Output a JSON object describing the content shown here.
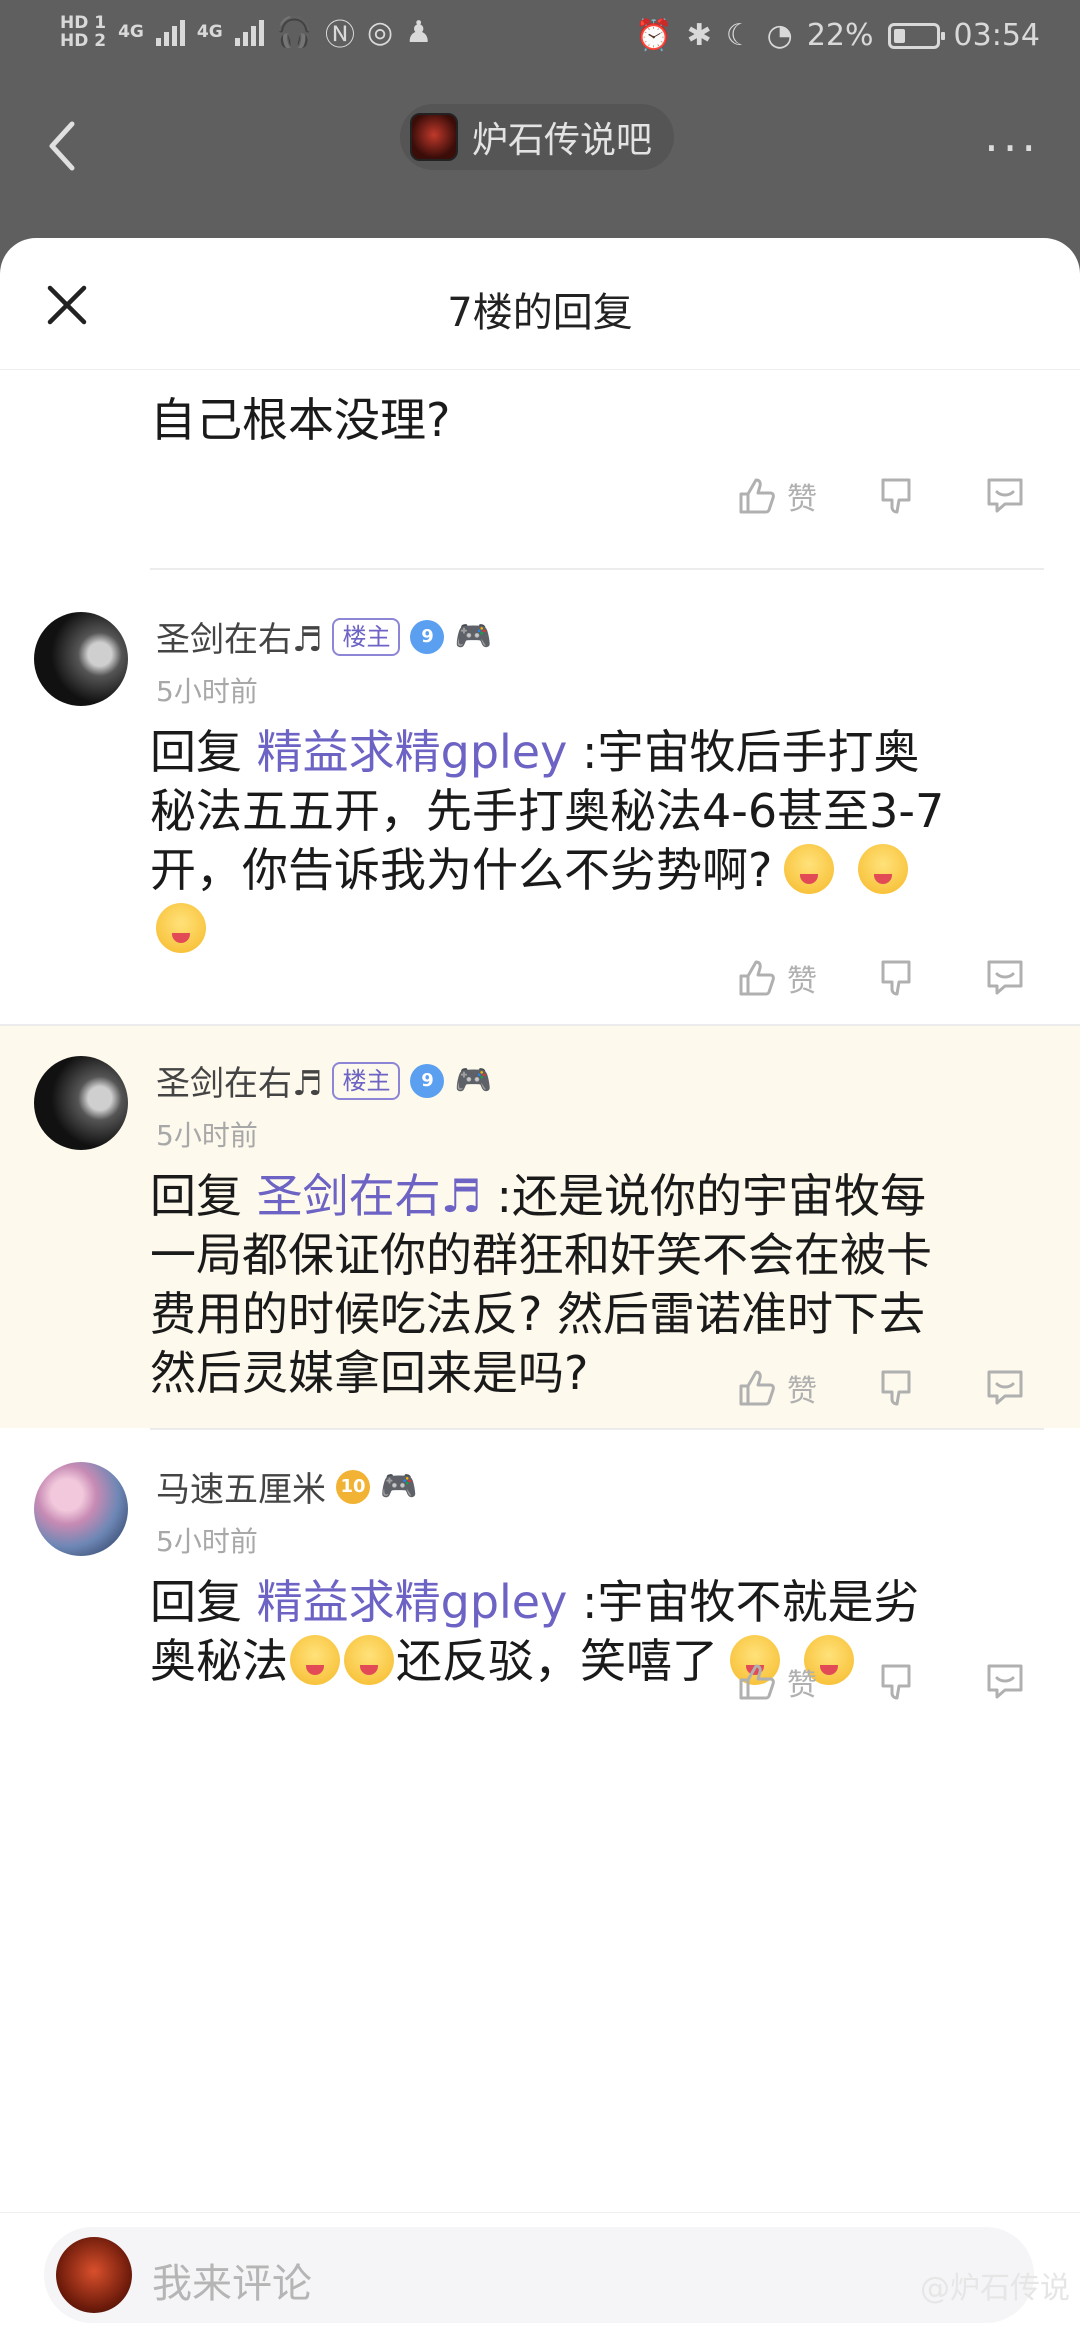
{
  "status_bar": {
    "hd1": "HD 1",
    "hd2": "HD 2",
    "net": "4G",
    "battery": "22%",
    "time": "03:54"
  },
  "header": {
    "forum_name": "炉石传说吧",
    "more": "···"
  },
  "sheet": {
    "title": "7楼的回复",
    "continued_text": "自己根本没理?"
  },
  "actions": {
    "like_label": "赞"
  },
  "replies": [
    {
      "username": "圣剑在右♬",
      "owner_badge": "楼主",
      "level": "9",
      "time": "5小时前",
      "prefix": "回复 ",
      "target": "精益求精gpley",
      "line1_rest": " :宇宙牧后手打奥",
      "line2": "秘法五五开，先手打奥秘法4-6甚至3-7",
      "line3": "开，你告诉我为什么不劣势啊?"
    },
    {
      "username": "圣剑在右♬",
      "owner_badge": "楼主",
      "level": "9",
      "time": "5小时前",
      "prefix": "回复 ",
      "target": "圣剑在右♬",
      "line1_rest": " :还是说你的宇宙牧每",
      "line2": "一局都保证你的群狂和奸笑不会在被卡",
      "line3": "费用的时候吃法反? 然后雷诺准时下去",
      "line4": "然后灵媒拿回来是吗?"
    },
    {
      "username": "马速五厘米",
      "level": "10",
      "time": "5小时前",
      "prefix": "回复 ",
      "target": "精益求精gpley",
      "line1_rest": " :宇宙牧不就是劣",
      "line2_a": "奥秘法",
      "line2_b": "还反驳，笑嘻了"
    }
  ],
  "comment_input": {
    "placeholder": "我来评论",
    "watermark": "@炉石传说"
  }
}
